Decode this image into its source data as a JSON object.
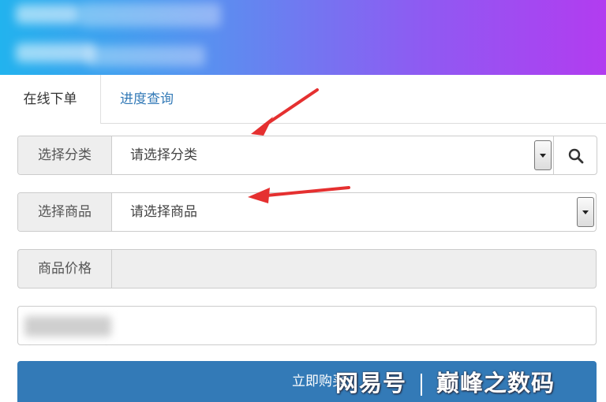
{
  "tabs": [
    {
      "label": "在线下单",
      "active": true
    },
    {
      "label": "进度查询",
      "active": false
    }
  ],
  "form": {
    "category": {
      "label": "选择分类",
      "placeholder": "请选择分类"
    },
    "product": {
      "label": "选择商品",
      "placeholder": "请选择商品"
    },
    "price": {
      "label": "商品价格",
      "value": ""
    }
  },
  "buy_button": {
    "label": "立即购买"
  },
  "watermark": {
    "left": "网易号",
    "right": "巅峰之数码"
  },
  "icons": {
    "search": "search-icon",
    "dropdown": "chevron-down-icon",
    "annotation": "red-arrow-icon"
  },
  "colors": {
    "header_start": "#22b3ee",
    "header_end": "#b23cf0",
    "primary": "#337ab7",
    "link": "#337ab7",
    "arrow": "#e53030"
  }
}
